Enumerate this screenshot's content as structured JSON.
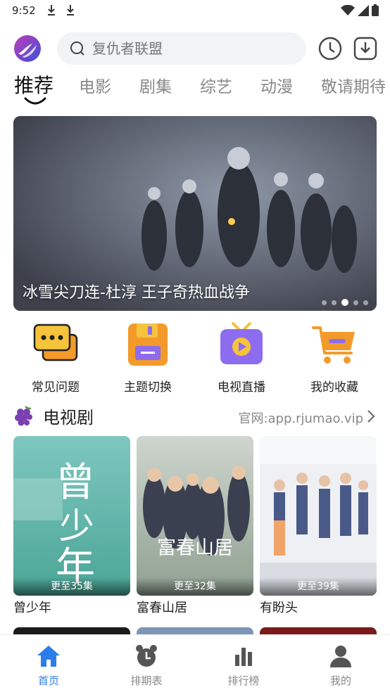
{
  "status_bar": {
    "time": "9:52"
  },
  "search": {
    "placeholder": "复仇者联盟"
  },
  "tabs": [
    {
      "label": "推荐",
      "active": true
    },
    {
      "label": "电影"
    },
    {
      "label": "剧集"
    },
    {
      "label": "综艺"
    },
    {
      "label": "动漫"
    },
    {
      "label": "敬请期待"
    }
  ],
  "banner": {
    "caption": "冰雪尖刀连-杜淳 王子奇热血战争",
    "slide_count": 5,
    "active_slide": 3
  },
  "quick_links": [
    {
      "label": "常见问题",
      "icon": "chat-bubbles-icon"
    },
    {
      "label": "主题切换",
      "icon": "floppy-disk-icon"
    },
    {
      "label": "电视直播",
      "icon": "tv-play-icon"
    },
    {
      "label": "我的收藏",
      "icon": "shopping-cart-icon"
    }
  ],
  "section": {
    "title": "电视剧",
    "link": "官网:app.rjumao.vip"
  },
  "cards": [
    {
      "title": "曾少年",
      "badge": "更至35集",
      "poster_text": "曾少年"
    },
    {
      "title": "富春山居",
      "badge": "更至32集",
      "poster_text": "富春山居"
    },
    {
      "title": "有盼头",
      "badge": "更至39集",
      "poster_text": ""
    }
  ],
  "bottom_nav": [
    {
      "label": "首页",
      "icon": "home-icon",
      "active": true
    },
    {
      "label": "排期表",
      "icon": "alarm-clock-icon"
    },
    {
      "label": "排行榜",
      "icon": "bar-chart-icon"
    },
    {
      "label": "我的",
      "icon": "user-icon"
    }
  ],
  "colors": {
    "accent": "#2b7de9",
    "icon_yellow": "#f5c43a",
    "icon_orange": "#f39a2b",
    "icon_purple": "#8e6cf0"
  }
}
